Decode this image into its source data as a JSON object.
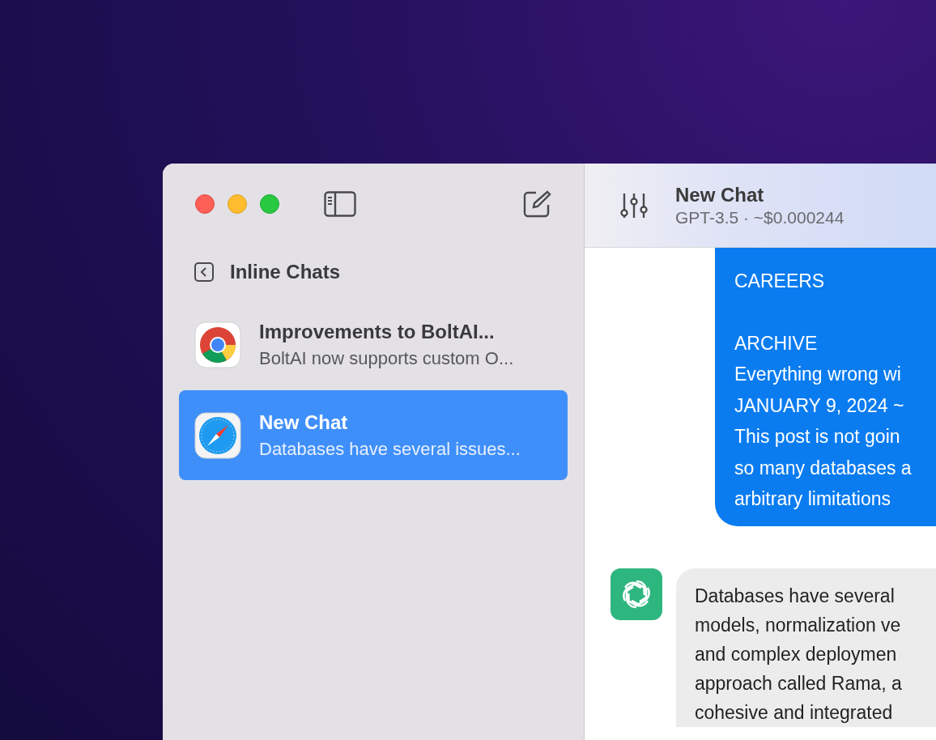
{
  "sidebar": {
    "section_title": "Inline Chats",
    "items": [
      {
        "kind": "chrome",
        "title": "Improvements to BoltAI...",
        "preview": "BoltAI now supports custom O...",
        "selected": false
      },
      {
        "kind": "safari",
        "title": "New Chat",
        "preview": "Databases have several issues...",
        "selected": true
      }
    ]
  },
  "chat": {
    "title": "New Chat",
    "subtitle": "GPT-3.5 · ~$0.000244",
    "messages": [
      {
        "kind": "user",
        "paragraphs": [
          [
            "CAREERS"
          ],
          [
            "ARCHIVE",
            "Everything wrong wi",
            "JANUARY 9, 2024 ~",
            "This post is not goin",
            "so many databases a",
            "arbitrary limitations"
          ]
        ]
      },
      {
        "kind": "assistant",
        "paragraphs": [
          [
            "Databases have several",
            "models, normalization ve",
            "and complex deploymen",
            "approach called Rama, a",
            "cohesive and integrated"
          ]
        ]
      }
    ]
  }
}
